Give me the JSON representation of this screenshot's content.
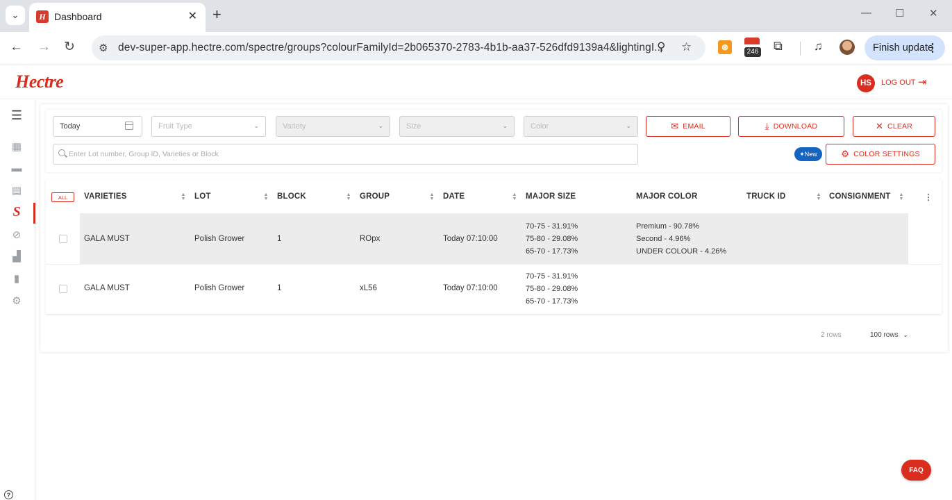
{
  "browser": {
    "tab_title": "Dashboard",
    "tab_favicon": "hectre-favicon",
    "new_tab": "+",
    "url": "dev-super-app.hectre.com/spectre/groups?colourFamilyId=2b065370-2783-4b1b-aa37-526dfd9139a4&lightingI...",
    "extension_badge": "246",
    "finish_update": "Finish update",
    "icons": [
      "chevron-down-icon",
      "close-icon",
      "minimize-icon",
      "maximize-icon",
      "back-icon",
      "forward-icon",
      "reload-icon",
      "site-info-icon",
      "zoom-icon",
      "star-icon",
      "hubspot-icon",
      "calendar-icon",
      "puzzle-icon",
      "media-icon",
      "profile-icon",
      "kebab-icon"
    ]
  },
  "app": {
    "logo": "Hectre",
    "user_initials": "HS",
    "logout_label": "LOG OUT",
    "accent": "#d92d20",
    "sidebar_icons": [
      "menu-toggle-icon",
      "crate-icon",
      "bin-icon",
      "report-icon",
      "spectre-icon",
      "disabled-icon",
      "analytics-icon",
      "clipboard-icon",
      "settings-icon",
      "help-icon"
    ],
    "spectre_letter": "S"
  },
  "filters": {
    "date": "Today",
    "fruit_type": "Fruit Type",
    "variety": "Variety",
    "size": "Size",
    "color": "Color",
    "email_label": "EMAIL",
    "download_label": "DOWNLOAD",
    "clear_label": "CLEAR",
    "search_placeholder": "Enter Lot number, Group ID, Varieties or Block",
    "new_badge": "New",
    "color_settings_label": "COLOR SETTINGS"
  },
  "table": {
    "all_label": "ALL",
    "columns": [
      "VARIETIES",
      "LOT",
      "BLOCK",
      "GROUP",
      "DATE",
      "MAJOR SIZE",
      "MAJOR COLOR",
      "TRUCK ID",
      "CONSIGNMENT"
    ],
    "rows": [
      {
        "variety": "GALA MUST",
        "lot": "Polish Grower",
        "block": "1",
        "group": "ROpx",
        "date": "Today 07:10:00",
        "major_size": [
          "70-75 - 31.91%",
          "75-80 - 29.08%",
          "65-70 - 17.73%"
        ],
        "major_color": [
          "Premium - 90.78%",
          "Second - 4.96%",
          "UNDER COLOUR - 4.26%"
        ],
        "truck_id": "",
        "consignment": ""
      },
      {
        "variety": "GALA MUST",
        "lot": "Polish Grower",
        "block": "1",
        "group": "xL56",
        "date": "Today 07:10:00",
        "major_size": [
          "70-75 - 31.91%",
          "75-80 - 29.08%",
          "65-70 - 17.73%"
        ],
        "major_color": [],
        "truck_id": "",
        "consignment": ""
      }
    ],
    "row_count": "2 rows",
    "page_size": "100 rows"
  },
  "faq_label": "FAQ"
}
